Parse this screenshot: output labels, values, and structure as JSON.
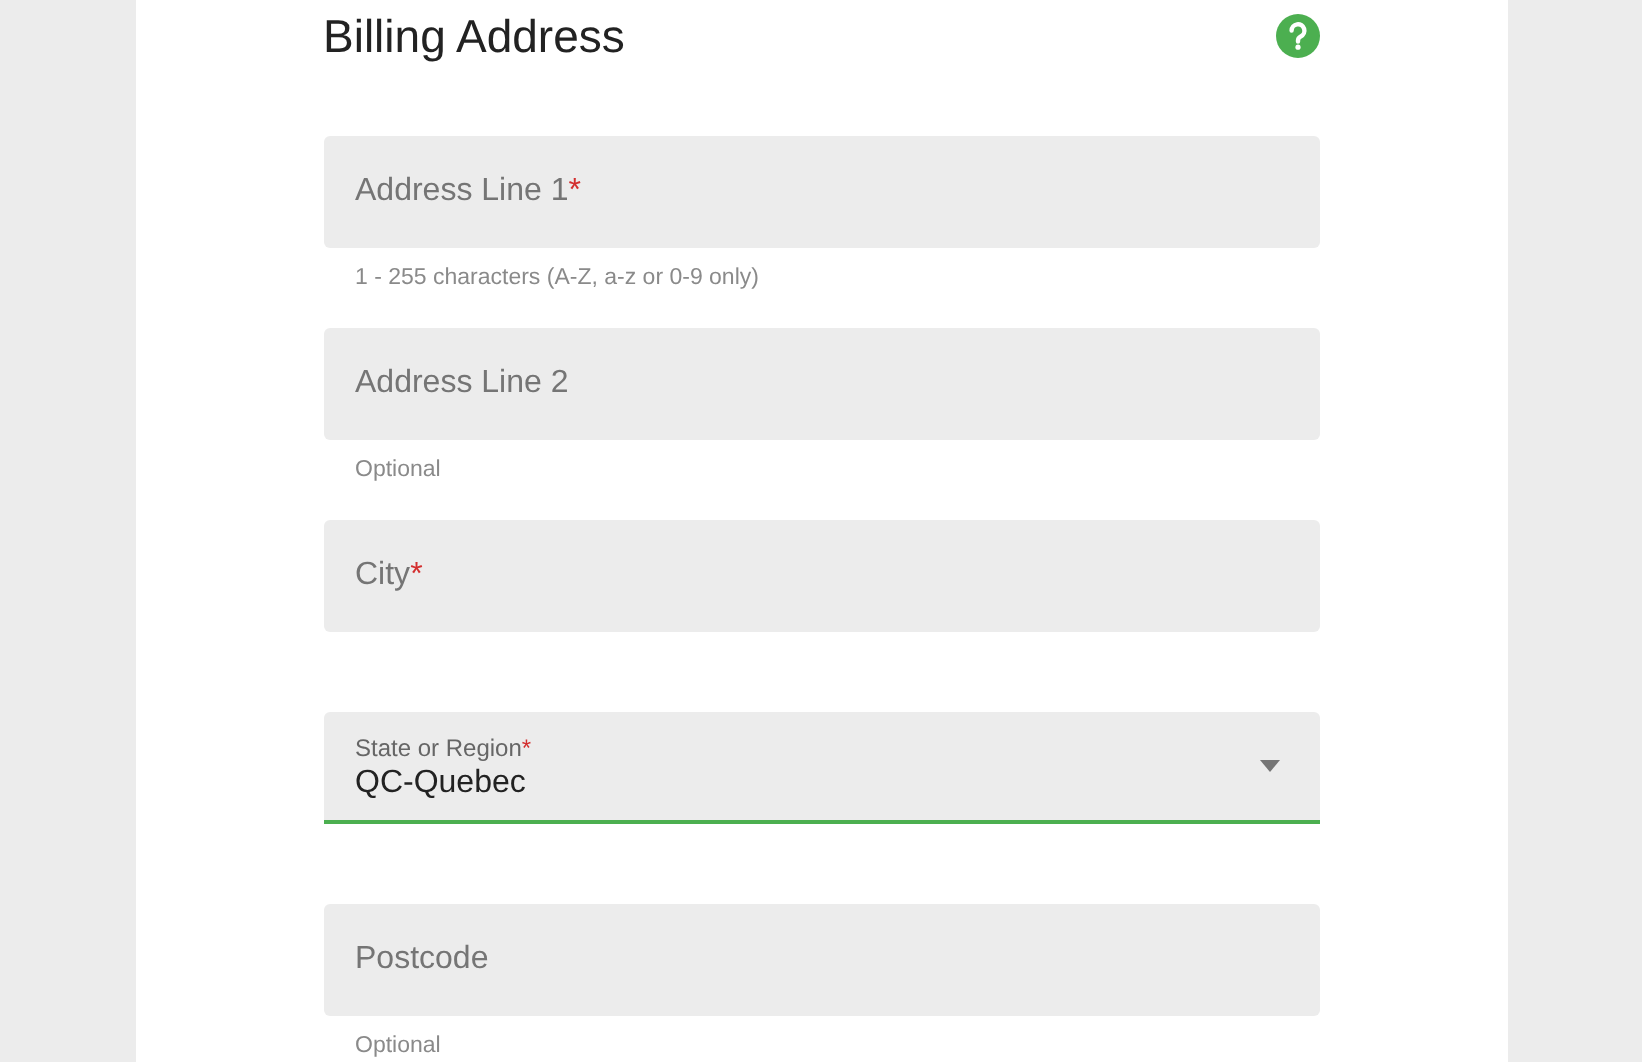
{
  "title": "Billing Address",
  "fields": [
    {
      "kind": "text",
      "placeholder": "Address Line 1",
      "mark": "*",
      "helper": "1 - 255 characters (A-Z, a-z or 0-9 only)"
    },
    {
      "kind": "text",
      "placeholder": "Address Line 2",
      "helper": "Optional"
    },
    {
      "kind": "text",
      "placeholder": "City",
      "mark": "*"
    },
    {
      "kind": "select",
      "label": "State or Region",
      "mark": "*",
      "value": "QC-Quebec",
      "focused": true
    },
    {
      "kind": "text",
      "placeholder": "Postcode",
      "helper": "Optional"
    }
  ]
}
